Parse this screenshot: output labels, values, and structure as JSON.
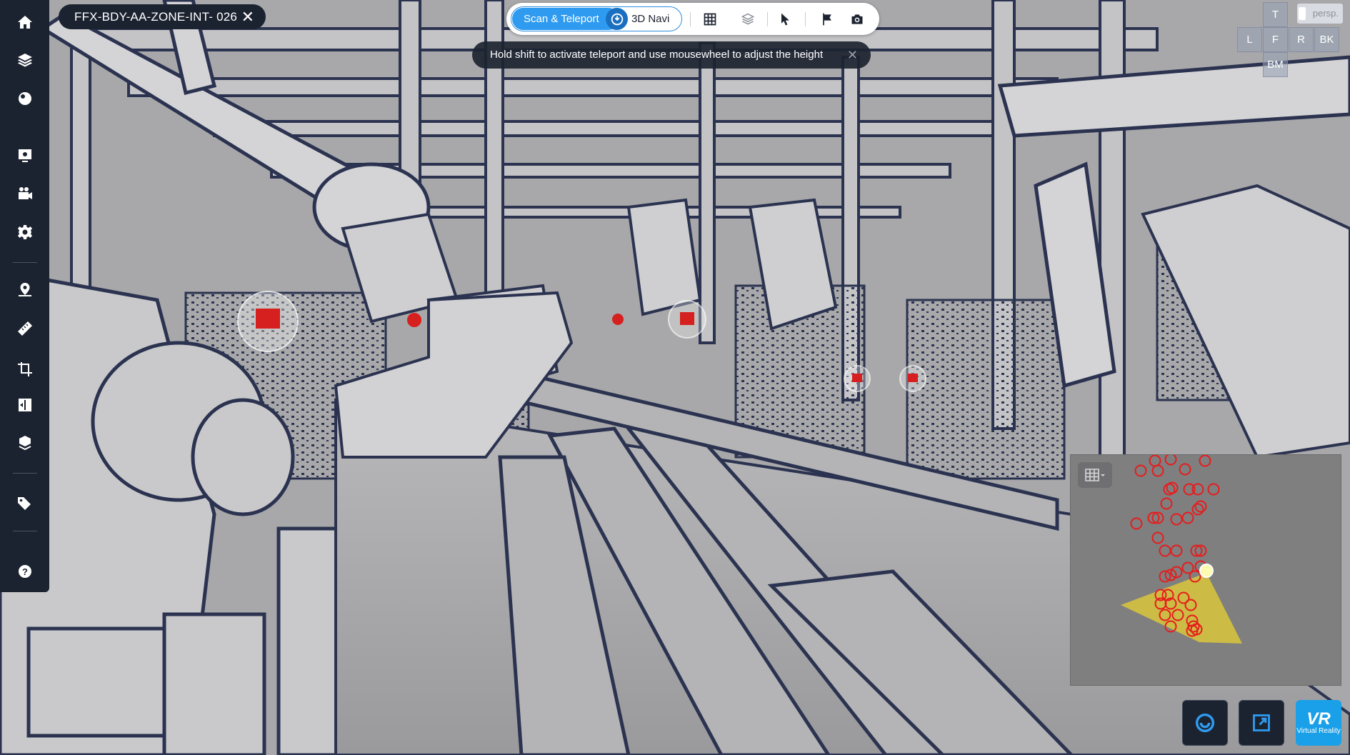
{
  "scan_tab": {
    "title": "FFX-BDY-AA-ZONE-INT- 026",
    "close": "✕"
  },
  "sidebar": {
    "items": [
      {
        "name": "home-icon"
      },
      {
        "name": "layers-icon"
      },
      {
        "name": "sphere-icon"
      },
      {
        "name": "snapshot-icon"
      },
      {
        "name": "video-icon"
      },
      {
        "name": "settings-icon"
      },
      {
        "name": "location-pin-icon"
      },
      {
        "name": "ruler-icon"
      },
      {
        "name": "crop-icon"
      },
      {
        "name": "compare-icon"
      },
      {
        "name": "model-icon"
      },
      {
        "name": "tags-icon"
      },
      {
        "name": "help-icon"
      }
    ]
  },
  "toolbar": {
    "mode_scan": "Scan & Teleport",
    "mode_navi": "3D Navi",
    "active_mode": "Scan & Teleport",
    "tools": [
      "grid-icon",
      "layers-3d-icon",
      "cursor-icon",
      "flag-icon",
      "camera-icon"
    ]
  },
  "tooltip": {
    "text": "Hold shift to activate teleport and use mousewheel to adjust the height",
    "close": "✕"
  },
  "view_cube": {
    "persp": "persp.",
    "top": "T",
    "left": "L",
    "front": "F",
    "right": "R",
    "back": "BK",
    "bottom": "BM"
  },
  "minimap": {
    "button_icon": "grid-dropdown-icon",
    "scan_point_color": "#e61d1d",
    "current_point_color": "#fffbb0",
    "view_cone_color": "#d9c53a"
  },
  "bottom_buttons": {
    "walk_icon": "walk-mode-icon",
    "fullscreen_icon": "fullscreen-icon",
    "vr_big": "VR",
    "vr_small": "Virtual Reality"
  },
  "colors": {
    "sidebar_bg": "#1c2330",
    "accent": "#2f9bf0",
    "vr_button": "#1aa0e8"
  }
}
